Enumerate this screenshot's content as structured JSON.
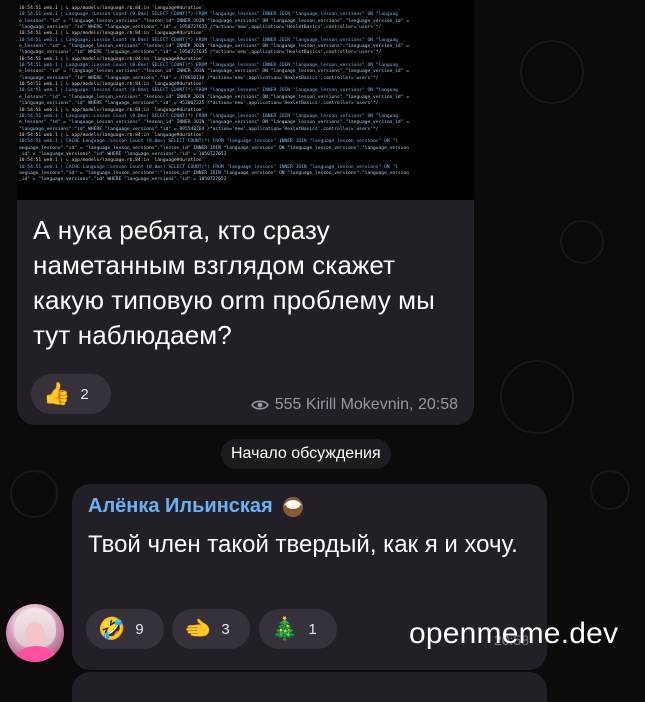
{
  "post": {
    "log_lines": [
      "10:54:51 web.1  |   ↳ app/models/language.rb:84:in `language#duration'",
      "10:54:51 web.1  |   Language::Lesson Count (0.0ms)  SELECT COUNT(*) FROM \"language_lessons\" INNER JOIN \"language_lesson_versions\" ON \"languag",
      "e_lessons\".\"id\" = \"language_lesson_versions\".\"lesson_id\" INNER JOIN \"language_versions\" ON \"language_lesson_versions\".\"language_version_id\" =",
      "\"language_versions\".\"id\" WHERE \"language_versions\".\"id\" = 1950727635 /*action='new',application='HexletBasics',controller='users'*/",
      "10:54:51 web.1  |   ↳ app/models/language.rb:84:in `language#duration'",
      "10:54:51 web.1  |   Language::Lesson Count (0.0ms)  SELECT COUNT(*) FROM \"language_lessons\" INNER JOIN \"language_lesson_versions\" ON \"languag",
      "e_lessons\".\"id\" = \"language_lesson_versions\".\"lesson_id\" INNER JOIN \"language_versions\" ON \"language_lesson_versions\".\"language_version_id\" =",
      "\"language_versions\".\"id\" WHERE \"language_versions\".\"id\" = 1950727635 /*action='new',application='HexletBasics',controller='users'*/",
      "10:54:51 web.1  |   ↳ app/models/language.rb:84:in `language#duration'",
      "10:54:51 web.1  |   Language::Lesson Count (0.0ms)  SELECT COUNT(*) FROM \"language_lessons\" INNER JOIN \"language_lesson_versions\" ON \"languag",
      "e_lessons\".\"id\" = \"language_lesson_versions\".\"lesson_id\" INNER JOIN \"language_versions\" ON \"language_lesson_versions\".\"language_version_id\" =",
      "\"language_versions\".\"id\" WHERE \"language_versions\".\"id\" = 378610138 /*action='new',application='HexletBasics',controller='users'*/",
      "10:54:51 web.1  |   ↳ app/models/language.rb:84:in `language#duration'",
      "10:54:51 web.1  |   Language::Lesson Count (0.0ms)  SELECT COUNT(*) FROM \"language_lessons\" INNER JOIN \"language_lesson_versions\" ON \"languag",
      "e_lessons\".\"id\" = \"language_lesson_versions\".\"lesson_id\" INNER JOIN \"language_versions\" ON \"language_lesson_versions\".\"language_version_id\" =",
      "\"language_versions\".\"id\" WHERE \"language_versions\".\"id\" = 953007225 /*action='new',application='HexletBasics',controller='users'*/",
      "10:54:51 web.1  |   ↳ app/models/language.rb:84:in `language#duration'",
      "10:54:51 web.1  |   Language::Lesson Count (0.0ms)  SELECT COUNT(*) FROM \"language_lessons\" INNER JOIN \"language_lesson_versions\" ON \"languag",
      "e_lessons\".\"id\" = \"language_lesson_versions\".\"lesson_id\" INNER JOIN \"language_versions\" ON \"language_lesson_versions\".\"language_version_id\" =",
      "\"language_versions\".\"id\" WHERE \"language_versions\".\"id\" = 995548764 /*action='new',application='HexletBasics',controller='users'*/",
      "10:54:51 web.1  |   ↳ app/models/language.rb:84:in `language#duration'",
      "10:54:51 web.1  |   CACHE Language::Lesson Count (0.0ms)  SELECT COUNT(*) FROM \"language_lessons\" INNER JOIN \"language_lesson_versions\" ON \"l",
      "anguage_lessons\".\"id\" = \"language_lesson_versions\".\"lesson_id\" INNER JOIN \"language_versions\" ON \"language_lesson_versions\".\"language_version",
      "_id\" = \"language_versions\".\"id\" WHERE \"language_versions\".\"id\" = 1050727653",
      "10:54:51 web.1  |   ↳ app/models/language.rb:84:in `language#duration'",
      "10:54:51 web.1  |   CACHE Language::Lesson Count (0.0ms)  SELECT COUNT(*) FROM \"language_lessons\" INNER JOIN \"language_lesson_versions\" ON \"l",
      "anguage_lessons\".\"id\" = \"language_lesson_versions\".\"lesson_id\" INNER JOIN \"language_versions\" ON \"language_lesson_versions\".\"language_version",
      "_id\" = \"language_versions\".\"id\" WHERE \"language_versions\".\"id\" = 1050727653"
    ],
    "text": "А нука ребята, кто сразу наметанным взглядом скажет какую типовую orm проблему мы тут наблюдаем?",
    "reaction": {
      "emoji": "👍",
      "count": "2"
    },
    "views": "555",
    "author": "Kirill Mokevnin,",
    "time": "20:58"
  },
  "service_message": "Начало обсуждения",
  "reply": {
    "author": "Алёнка Ильинская",
    "author_icon": "coconut-icon",
    "text": "Твой член такой твердый, как я и хочу.",
    "reactions": [
      {
        "emoji": "🤣",
        "count": "9"
      },
      {
        "emoji": "🫲",
        "count": "3"
      },
      {
        "emoji": "🎄",
        "count": "1"
      }
    ],
    "time": "20:58"
  },
  "watermark": "openmeme.dev",
  "colors": {
    "background": "#0c0a0b",
    "bubble": "#231f27",
    "author_name": "#6ab2f2",
    "reaction_pill": "#36313a",
    "meta_text": "#9a95a0"
  }
}
